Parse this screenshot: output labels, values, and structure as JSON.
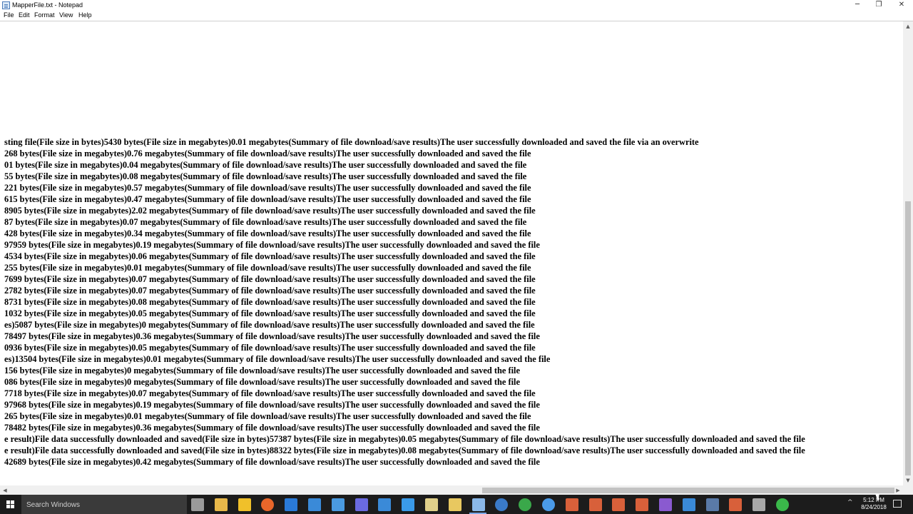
{
  "window": {
    "title": "MapperFile.txt - Notepad",
    "controls": {
      "minimize": "─",
      "maximize": "❐",
      "close": "✕"
    }
  },
  "menu": {
    "file": "File",
    "edit": "Edit",
    "format": "Format",
    "view": "View",
    "help": "Help"
  },
  "editor": {
    "lines": [
      "sting file(File size in bytes)5430 bytes(File size in megabytes)0.01 megabytes(Summary of file download/save results)The user successfully downloaded and saved the file via an overwrite",
      "268 bytes(File size in megabytes)0.76 megabytes(Summary of file download/save results)The user successfully downloaded and saved the file",
      "01 bytes(File size in megabytes)0.04 megabytes(Summary of file download/save results)The user successfully downloaded and saved the file",
      "55 bytes(File size in megabytes)0.08 megabytes(Summary of file download/save results)The user successfully downloaded and saved the file",
      "221 bytes(File size in megabytes)0.57 megabytes(Summary of file download/save results)The user successfully downloaded and saved the file",
      "615 bytes(File size in megabytes)0.47 megabytes(Summary of file download/save results)The user successfully downloaded and saved the file",
      "8905 bytes(File size in megabytes)2.02 megabytes(Summary of file download/save results)The user successfully downloaded and saved the file",
      "87 bytes(File size in megabytes)0.07 megabytes(Summary of file download/save results)The user successfully downloaded and saved the file",
      "428 bytes(File size in megabytes)0.34 megabytes(Summary of file download/save results)The user successfully downloaded and saved the file",
      "97959 bytes(File size in megabytes)0.19 megabytes(Summary of file download/save results)The user successfully downloaded and saved the file",
      "4534 bytes(File size in megabytes)0.06 megabytes(Summary of file download/save results)The user successfully downloaded and saved the file",
      "255 bytes(File size in megabytes)0.01 megabytes(Summary of file download/save results)The user successfully downloaded and saved the file",
      "7699 bytes(File size in megabytes)0.07 megabytes(Summary of file download/save results)The user successfully downloaded and saved the file",
      "2782 bytes(File size in megabytes)0.07 megabytes(Summary of file download/save results)The user successfully downloaded and saved the file",
      "8731 bytes(File size in megabytes)0.08 megabytes(Summary of file download/save results)The user successfully downloaded and saved the file",
      "1032 bytes(File size in megabytes)0.05 megabytes(Summary of file download/save results)The user successfully downloaded and saved the file",
      "es)5087 bytes(File size in megabytes)0 megabytes(Summary of file download/save results)The user successfully downloaded and saved the file",
      "78497 bytes(File size in megabytes)0.36 megabytes(Summary of file download/save results)The user successfully downloaded and saved the file",
      "0936 bytes(File size in megabytes)0.05 megabytes(Summary of file download/save results)The user successfully downloaded and saved the file",
      "es)13504 bytes(File size in megabytes)0.01 megabytes(Summary of file download/save results)The user successfully downloaded and saved the file",
      "156 bytes(File size in megabytes)0 megabytes(Summary of file download/save results)The user successfully downloaded and saved the file",
      "086 bytes(File size in megabytes)0 megabytes(Summary of file download/save results)The user successfully downloaded and saved the file",
      "7718 bytes(File size in megabytes)0.07 megabytes(Summary of file download/save results)The user successfully downloaded and saved the file",
      "97968 bytes(File size in megabytes)0.19 megabytes(Summary of file download/save results)The user successfully downloaded and saved the file",
      "265 bytes(File size in megabytes)0.01 megabytes(Summary of file download/save results)The user successfully downloaded and saved the file",
      "78482 bytes(File size in megabytes)0.36 megabytes(Summary of file download/save results)The user successfully downloaded and saved the file",
      "e result)File data successfully downloaded and saved(File size in bytes)57387 bytes(File size in megabytes)0.05 megabytes(Summary of file download/save results)The user successfully downloaded and saved the file",
      "e result)File data successfully downloaded and saved(File size in bytes)88322 bytes(File size in megabytes)0.08 megabytes(Summary of file download/save results)The user successfully downloaded and saved the file",
      "42689 bytes(File size in megabytes)0.42 megabytes(Summary of file download/save results)The user successfully downloaded and saved the file"
    ]
  },
  "scrollbars": {
    "arrow_up": "▲",
    "arrow_down": "▼",
    "arrow_left": "◀",
    "arrow_right": "▶"
  },
  "taskbar": {
    "search_placeholder": "Search Windows",
    "tray_chevron": "^",
    "clock_time": "5:12 PM",
    "clock_date": "8/24/2018",
    "icons": [
      {
        "name": "task-view-icon",
        "color": "#9a9a9a"
      },
      {
        "name": "file-explorer-icon",
        "color": "#e8b84a"
      },
      {
        "name": "store-icon",
        "color": "#f0c02a"
      },
      {
        "name": "firefox-icon",
        "color": "#e8662a"
      },
      {
        "name": "app-blue-icon",
        "color": "#2a7ad8"
      },
      {
        "name": "mail-icon",
        "color": "#3a8ad8"
      },
      {
        "name": "app-ship-icon",
        "color": "#4a9ae0"
      },
      {
        "name": "app-purple-icon",
        "color": "#6a6ae0"
      },
      {
        "name": "visual-studio-code-icon",
        "color": "#3a8ad8"
      },
      {
        "name": "app-plane-icon",
        "color": "#3a9ae8"
      },
      {
        "name": "document-icon",
        "color": "#e0d08a"
      },
      {
        "name": "folder-icon",
        "color": "#e8c860"
      },
      {
        "name": "notepad-icon",
        "color": "#8ab8e8"
      },
      {
        "name": "app-globe-icon",
        "color": "#3a7ac8"
      },
      {
        "name": "chrome-icon",
        "color": "#3aa84a"
      },
      {
        "name": "browser-icon",
        "color": "#4a9ae8"
      },
      {
        "name": "app-chart-icon",
        "color": "#d8603a"
      },
      {
        "name": "app-chart-icon-2",
        "color": "#d8603a"
      },
      {
        "name": "app-chart-icon-3",
        "color": "#d8603a"
      },
      {
        "name": "app-chart-icon-4",
        "color": "#d8603a"
      },
      {
        "name": "visual-studio-icon",
        "color": "#8a5ad0"
      },
      {
        "name": "app-blue-icon-2",
        "color": "#3a8ad8"
      },
      {
        "name": "steam-icon",
        "color": "#5a7aa8"
      },
      {
        "name": "app-chart-icon-5",
        "color": "#d8603a"
      },
      {
        "name": "app-gray-icon",
        "color": "#a8a8a8"
      },
      {
        "name": "download-icon",
        "color": "#3ab84a"
      }
    ]
  }
}
